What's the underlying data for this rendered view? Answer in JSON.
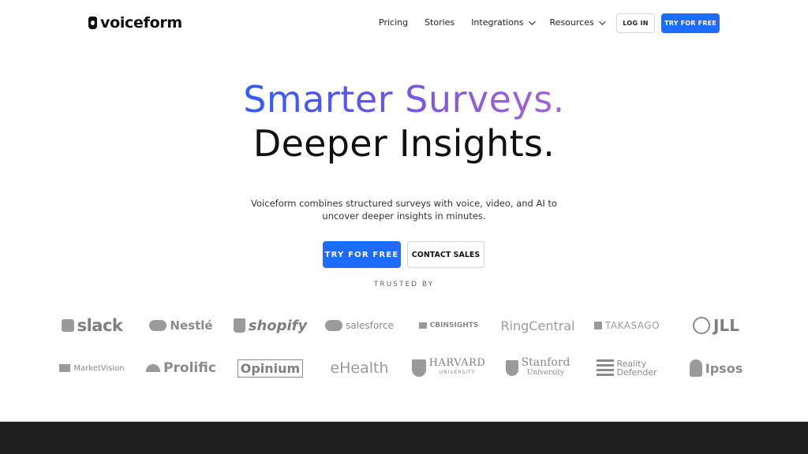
{
  "nav": {
    "brand": "voiceform",
    "links": [
      {
        "label": "Pricing",
        "has_dropdown": false
      },
      {
        "label": "Stories",
        "has_dropdown": false
      },
      {
        "label": "Integrations",
        "has_dropdown": true
      },
      {
        "label": "Resources",
        "has_dropdown": true
      }
    ],
    "login_label": "LOG IN",
    "try_label": "TRY FOR FREE"
  },
  "hero": {
    "headline_1": "Smarter Surveys.",
    "headline_2": "Deeper Insights.",
    "subtext": "Voiceform combines structured surveys with voice, video, and AI to uncover deeper insights in minutes.",
    "cta_primary": "TRY FOR FREE",
    "cta_secondary": "CONTACT SALES"
  },
  "trusted": {
    "label": "TRUSTED BY",
    "logos_row_1": [
      "slack",
      "Nestlé",
      "shopify",
      "salesforce",
      "CBINSIGHTS",
      "RingCentral",
      "TAKASAGO",
      "JLL"
    ],
    "logos_row_2": [
      "MarketVision",
      "Prolific",
      "Opinium",
      "eHealth",
      "HARVARD",
      "Stanford",
      "Reality Defender",
      "Ipsos"
    ],
    "harvard_sub": "UNIVERSITY",
    "stanford_sub": "University"
  },
  "colors": {
    "accent": "#1e6bff",
    "headline_gradient": [
      "#2f5cff",
      "#a466d6"
    ],
    "footer": "#1f1f1f"
  }
}
